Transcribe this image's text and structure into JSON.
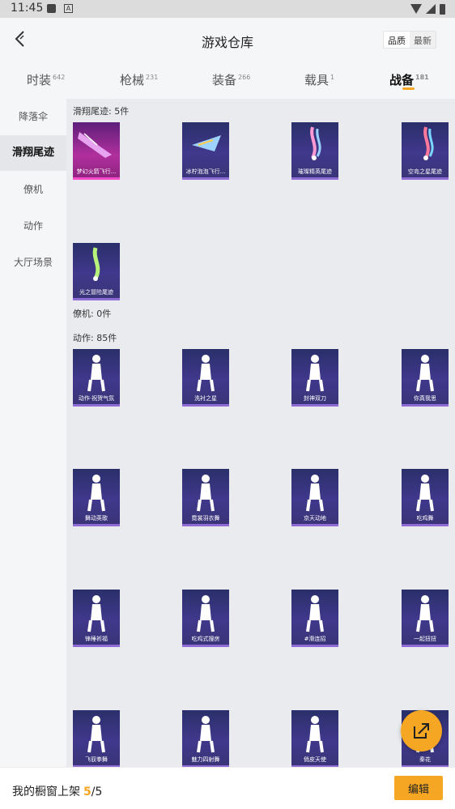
{
  "status_bar": {
    "time": "11:45",
    "icon_b": "A"
  },
  "header": {
    "title": "游戏仓库",
    "sort_options": [
      "品质",
      "最新"
    ]
  },
  "tabs": [
    {
      "label": "时装",
      "count": "642"
    },
    {
      "label": "枪械",
      "count": "231"
    },
    {
      "label": "装备",
      "count": "266"
    },
    {
      "label": "载具",
      "count": "1"
    },
    {
      "label": "战备",
      "count": "181"
    }
  ],
  "sidebar": {
    "items": [
      "降落伞",
      "滑翔尾迹",
      "僚机",
      "动作",
      "大厅场景"
    ]
  },
  "sections": {
    "glide": {
      "title": "滑翔尾迹: 5件",
      "items": [
        "梦幻火箭飞行...",
        "冰柠泡泡飞行...",
        "璀璨精英尾迹",
        "空岛之星尾迹",
        "光之冒险尾迹"
      ]
    },
    "wingman": {
      "title": "僚机: 0件"
    },
    "actions": {
      "title": "动作: 85件",
      "items": [
        "动作·祝贺气氛",
        "洗衬之星",
        "封神双刀",
        "你真我思",
        "舞动英歌",
        "霓裳羽衣舞",
        "京天动地",
        "吃鸡舞",
        "锋睡祈福",
        "吃鸡式搜房",
        "#滑连招",
        "一起扭扭",
        "飞驭拳舞",
        "魅力四射舞",
        "俏皮天使",
        "秦花"
      ]
    }
  },
  "bottom": {
    "label": "我的橱窗上架",
    "count_current": "5",
    "count_sep": "/",
    "count_total": "5",
    "edit_label": "编辑"
  },
  "colors": {
    "accent": "#f5a623",
    "card_bg": "#3a3478",
    "card_pink": "#b02f9e"
  }
}
